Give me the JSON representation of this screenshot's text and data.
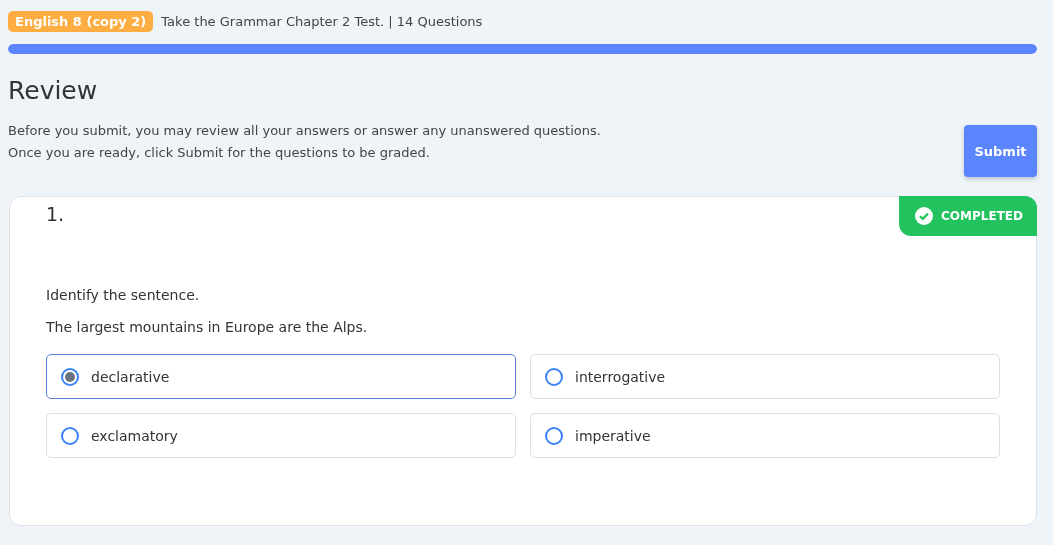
{
  "header": {
    "course_badge": "English 8 (copy 2)",
    "title": "Take the Grammar Chapter 2 Test. | 14 Questions"
  },
  "progress": {
    "level": 1
  },
  "heading": "Review",
  "instructions": [
    "Before you submit, you may review all your answers or answer any unanswered questions.",
    "Once you are ready, click Submit for the questions to be graded."
  ],
  "submit_button": "Submit",
  "question": {
    "number": "1.",
    "status": "COMPLETED",
    "completed": true,
    "prompt": "Identify the sentence.",
    "sentence": "The largest mountains in Europe are the Alps.",
    "options": [
      {
        "label": "declarative",
        "selected": true
      },
      {
        "label": "interrogative",
        "selected": false
      },
      {
        "label": "exclamatory",
        "selected": false
      },
      {
        "label": "imperative",
        "selected": false
      }
    ]
  }
}
